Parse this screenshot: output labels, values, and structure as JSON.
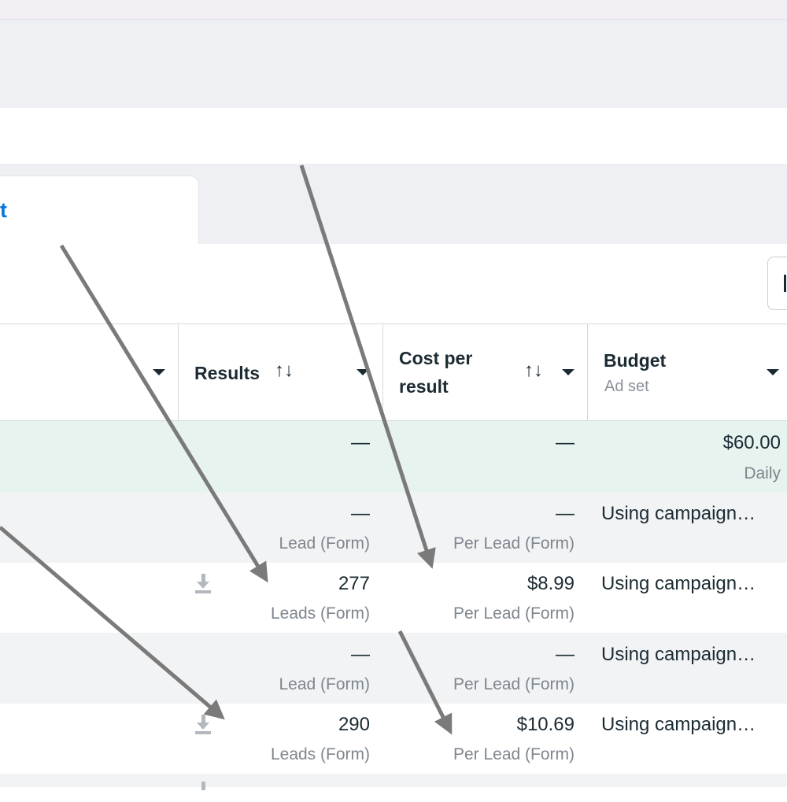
{
  "tab": {
    "label": "t"
  },
  "columns": {
    "results": {
      "label": "Results",
      "sort_icon": "sort-up-down-icon"
    },
    "cost": {
      "label_line1": "Cost per",
      "label_line2": "result",
      "sort_icon": "sort-up-down-icon"
    },
    "budget": {
      "label": "Budget",
      "sublabel": "Ad set"
    }
  },
  "rows": [
    {
      "results": "—",
      "results_sub": "",
      "cost": "—",
      "cost_sub": "",
      "budget": "$60.00",
      "budget_sub": "Daily",
      "download": false
    },
    {
      "results": "—",
      "results_sub": "Lead (Form)",
      "cost": "—",
      "cost_sub": "Per Lead (Form)",
      "budget": "Using campaign…",
      "download": false
    },
    {
      "results": "277",
      "results_sub": "Leads (Form)",
      "cost": "$8.99",
      "cost_sub": "Per Lead (Form)",
      "budget": "Using campaign…",
      "download": true
    },
    {
      "results": "—",
      "results_sub": "Lead (Form)",
      "cost": "—",
      "cost_sub": "Per Lead (Form)",
      "budget": "Using campaign…",
      "download": false
    },
    {
      "results": "290",
      "results_sub": "Leads (Form)",
      "cost": "$10.69",
      "cost_sub": "Per Lead (Form)",
      "budget": "Using campaign…",
      "download": true
    }
  ],
  "colors": {
    "accent": "#0a78d8",
    "summary_row": "#e6f3ee",
    "arrow": "#7a7a7a"
  }
}
